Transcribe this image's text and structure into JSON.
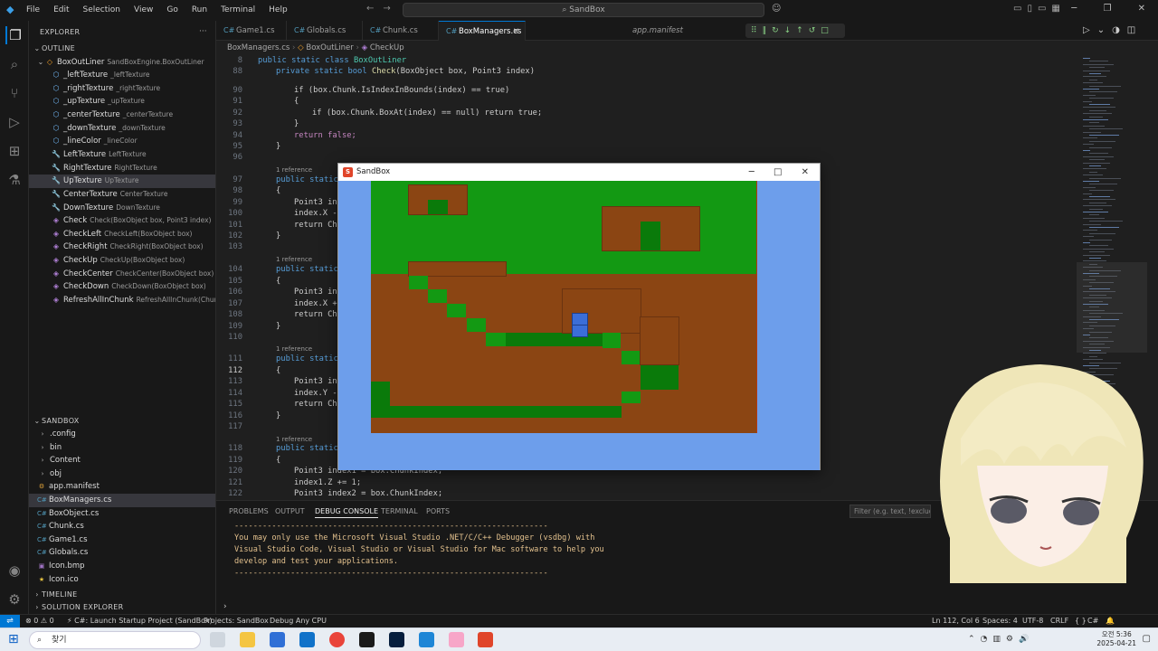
{
  "menu": {
    "items": [
      "File",
      "Edit",
      "Selection",
      "View",
      "Go",
      "Run",
      "Terminal",
      "Help"
    ],
    "search": "SandBox"
  },
  "sidebar": {
    "explorer_title": "EXPLORER",
    "outline_title": "OUTLINE",
    "outline_root": {
      "name": "BoxOutLiner",
      "detail": "SandBoxEngine.BoxOutLiner"
    },
    "outline_items": [
      {
        "name": "_leftTexture",
        "detail": "_leftTexture",
        "icon": "field"
      },
      {
        "name": "_rightTexture",
        "detail": "_rightTexture",
        "icon": "field"
      },
      {
        "name": "_upTexture",
        "detail": "_upTexture",
        "icon": "field"
      },
      {
        "name": "_centerTexture",
        "detail": "_centerTexture",
        "icon": "field"
      },
      {
        "name": "_downTexture",
        "detail": "_downTexture",
        "icon": "field"
      },
      {
        "name": "_lineColor",
        "detail": "_lineColor",
        "icon": "field"
      },
      {
        "name": "LeftTexture",
        "detail": "LeftTexture",
        "icon": "property"
      },
      {
        "name": "RightTexture",
        "detail": "RightTexture",
        "icon": "property"
      },
      {
        "name": "UpTexture",
        "detail": "UpTexture",
        "icon": "property"
      },
      {
        "name": "CenterTexture",
        "detail": "CenterTexture",
        "icon": "property"
      },
      {
        "name": "DownTexture",
        "detail": "DownTexture",
        "icon": "property"
      },
      {
        "name": "Check",
        "detail": "Check(BoxObject box, Point3 index)",
        "icon": "method"
      },
      {
        "name": "CheckLeft",
        "detail": "CheckLeft(BoxObject box)",
        "icon": "method"
      },
      {
        "name": "CheckRight",
        "detail": "CheckRight(BoxObject box)",
        "icon": "method"
      },
      {
        "name": "CheckUp",
        "detail": "CheckUp(BoxObject box)",
        "icon": "method"
      },
      {
        "name": "CheckCenter",
        "detail": "CheckCenter(BoxObject box)",
        "icon": "method"
      },
      {
        "name": "CheckDown",
        "detail": "CheckDown(BoxObject box)",
        "icon": "method"
      },
      {
        "name": "RefreshAllInChunk",
        "detail": "RefreshAllInChunk(Chunk...",
        "icon": "method"
      }
    ],
    "sandbox_title": "SANDBOX",
    "files": [
      {
        "name": ".config",
        "kind": "folder"
      },
      {
        "name": "bin",
        "kind": "folder"
      },
      {
        "name": "Content",
        "kind": "folder"
      },
      {
        "name": "obj",
        "kind": "folder"
      },
      {
        "name": "app.manifest",
        "kind": "manifest"
      },
      {
        "name": "BoxManagers.cs",
        "kind": "cs"
      },
      {
        "name": "BoxObject.cs",
        "kind": "cs"
      },
      {
        "name": "Chunk.cs",
        "kind": "cs"
      },
      {
        "name": "Game1.cs",
        "kind": "cs"
      },
      {
        "name": "Globals.cs",
        "kind": "cs"
      },
      {
        "name": "Icon.bmp",
        "kind": "image"
      },
      {
        "name": "Icon.ico",
        "kind": "icon"
      }
    ],
    "timeline_title": "TIMELINE",
    "solution_title": "SOLUTION EXPLORER"
  },
  "tabs": [
    "Game1.cs",
    "Globals.cs",
    "Chunk.cs",
    "BoxManagers.cs",
    "app.manifest"
  ],
  "breadcrumb": [
    "BoxManagers.cs",
    "BoxOutLiner",
    "CheckUp"
  ],
  "code": {
    "line_numbers": [
      "8",
      "88",
      "90",
      "91",
      "92",
      "93",
      "94",
      "95",
      "96",
      "97",
      "98",
      "99",
      "100",
      "101",
      "102",
      "103",
      "104",
      "105",
      "106",
      "107",
      "108",
      "109",
      "110",
      "111",
      "112",
      "113",
      "114",
      "115",
      "116",
      "117",
      "118",
      "119",
      "120",
      "121",
      "122"
    ],
    "reference_label": "1 reference",
    "lines": {
      "l8": "public static class ",
      "l8b": "BoxOutLiner",
      "l88a": "private static bool ",
      "l88b": "Check",
      "l88c": "(BoxObject box, Point3 index)",
      "l90": "if (box.Chunk.IsIndexInBounds(index) == true)",
      "l91": "{",
      "l92": "if (box.Chunk.BoxAt(index) == null) return true;",
      "l93": "}",
      "l94": "return false;",
      "l95": "}",
      "l97": "public static",
      "l98": "{",
      "l99": "Point3 in",
      "l100": "index.X -",
      "l101": "return Ch",
      "l102": "}",
      "l104": "public static",
      "l105": "{",
      "l106": "Point3 in",
      "l107": "index.X +",
      "l108": "return Ch",
      "l109": "}",
      "l111": "public static",
      "l112": "{",
      "l113": "Point3 in",
      "l114": "index.Y -",
      "l115": "return Ch",
      "l116": "}",
      "l118": "public static",
      "l119": "{",
      "l120": "Point3 index1 = box.ChunkIndex;",
      "l121": "index1.Z += 1;",
      "l122": "Point3 index2 = box.ChunkIndex;"
    }
  },
  "panel": {
    "tabs": [
      "PROBLEMS",
      "OUTPUT",
      "DEBUG CONSOLE",
      "TERMINAL",
      "PORTS"
    ],
    "active_tab": "DEBUG CONSOLE",
    "filter_placeholder": "Filter (e.g. text, !exclude)",
    "console_lines": [
      "-------------------------------------------------------------------",
      "You may only use the Microsoft Visual Studio .NET/C/C++ Debugger (vsdbg) with",
      "Visual Studio Code, Visual Studio or Visual Studio for Mac software to help you",
      "develop and test your applications.",
      "-------------------------------------------------------------------"
    ]
  },
  "status": {
    "errors": "0",
    "warnings": "0",
    "launch": "C#: Launch Startup Project (SandBox)",
    "projects": "Projects: SandBox",
    "debug": "Debug Any CPU",
    "position": "Ln 112, Col 6",
    "spaces": "Spaces: 4",
    "encoding": "UTF-8",
    "eol": "CRLF",
    "braces": "{ }",
    "language": "C#"
  },
  "sandbox_window": {
    "title": "SandBox",
    "colors": {
      "sky": "#6d9eeb",
      "grass": "#139913",
      "dirt": "#8b4513",
      "selected": "#3b6ed8"
    }
  },
  "taskbar": {
    "search_label": "찾기",
    "time": "오전 5:36",
    "date": "2025-04-21"
  }
}
